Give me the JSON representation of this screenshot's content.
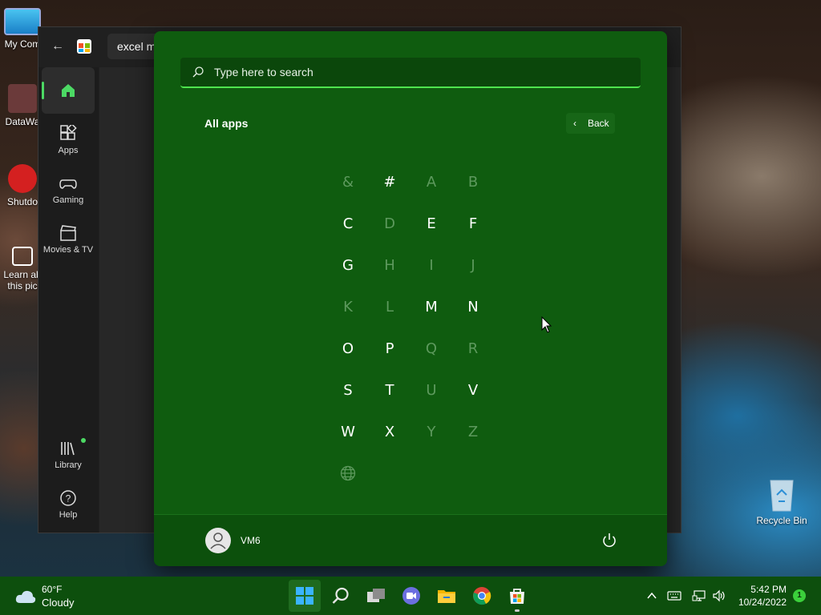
{
  "desktop": {
    "icons": [
      {
        "label": "My Com"
      },
      {
        "label": "DataWa"
      },
      {
        "label": "Shutdo"
      },
      {
        "label": "Learn ab this pic"
      }
    ],
    "recycle_bin": "Recycle Bin"
  },
  "store": {
    "search_value": "excel m",
    "nav": [
      {
        "label": ""
      },
      {
        "label": "Apps"
      },
      {
        "label": "Gaming"
      },
      {
        "label": "Movies & TV"
      },
      {
        "label": "Library"
      },
      {
        "label": "Help"
      }
    ]
  },
  "start_menu": {
    "search_placeholder": "Type here to search",
    "section_title": "All apps",
    "back_label": "Back",
    "letters": [
      {
        "char": "&",
        "enabled": false
      },
      {
        "char": "#",
        "enabled": true
      },
      {
        "char": "A",
        "enabled": false
      },
      {
        "char": "B",
        "enabled": false
      },
      {
        "char": "C",
        "enabled": true
      },
      {
        "char": "D",
        "enabled": false
      },
      {
        "char": "E",
        "enabled": true
      },
      {
        "char": "F",
        "enabled": true
      },
      {
        "char": "G",
        "enabled": true
      },
      {
        "char": "H",
        "enabled": false
      },
      {
        "char": "I",
        "enabled": false
      },
      {
        "char": "J",
        "enabled": false
      },
      {
        "char": "K",
        "enabled": false
      },
      {
        "char": "L",
        "enabled": false
      },
      {
        "char": "M",
        "enabled": true
      },
      {
        "char": "N",
        "enabled": true
      },
      {
        "char": "O",
        "enabled": true
      },
      {
        "char": "P",
        "enabled": true
      },
      {
        "char": "Q",
        "enabled": false
      },
      {
        "char": "R",
        "enabled": false
      },
      {
        "char": "S",
        "enabled": true
      },
      {
        "char": "T",
        "enabled": true
      },
      {
        "char": "U",
        "enabled": false
      },
      {
        "char": "V",
        "enabled": true
      },
      {
        "char": "W",
        "enabled": true
      },
      {
        "char": "X",
        "enabled": true
      },
      {
        "char": "Y",
        "enabled": false
      },
      {
        "char": "Z",
        "enabled": false
      }
    ],
    "user_name": "VM6"
  },
  "taskbar": {
    "weather_temp": "60°F",
    "weather_condition": "Cloudy",
    "time": "5:42 PM",
    "date": "10/24/2022",
    "notification_count": "1",
    "apps": [
      {
        "icon": "windows-start-icon"
      },
      {
        "icon": "search-icon"
      },
      {
        "icon": "task-view-icon"
      },
      {
        "icon": "teams-chat-icon"
      },
      {
        "icon": "file-explorer-icon"
      },
      {
        "icon": "chrome-icon"
      },
      {
        "icon": "microsoft-store-icon"
      }
    ]
  },
  "colors": {
    "start_bg": "#0f5c0f",
    "accent": "#4ee44e",
    "taskbar_bg": "#0d4f0d"
  }
}
